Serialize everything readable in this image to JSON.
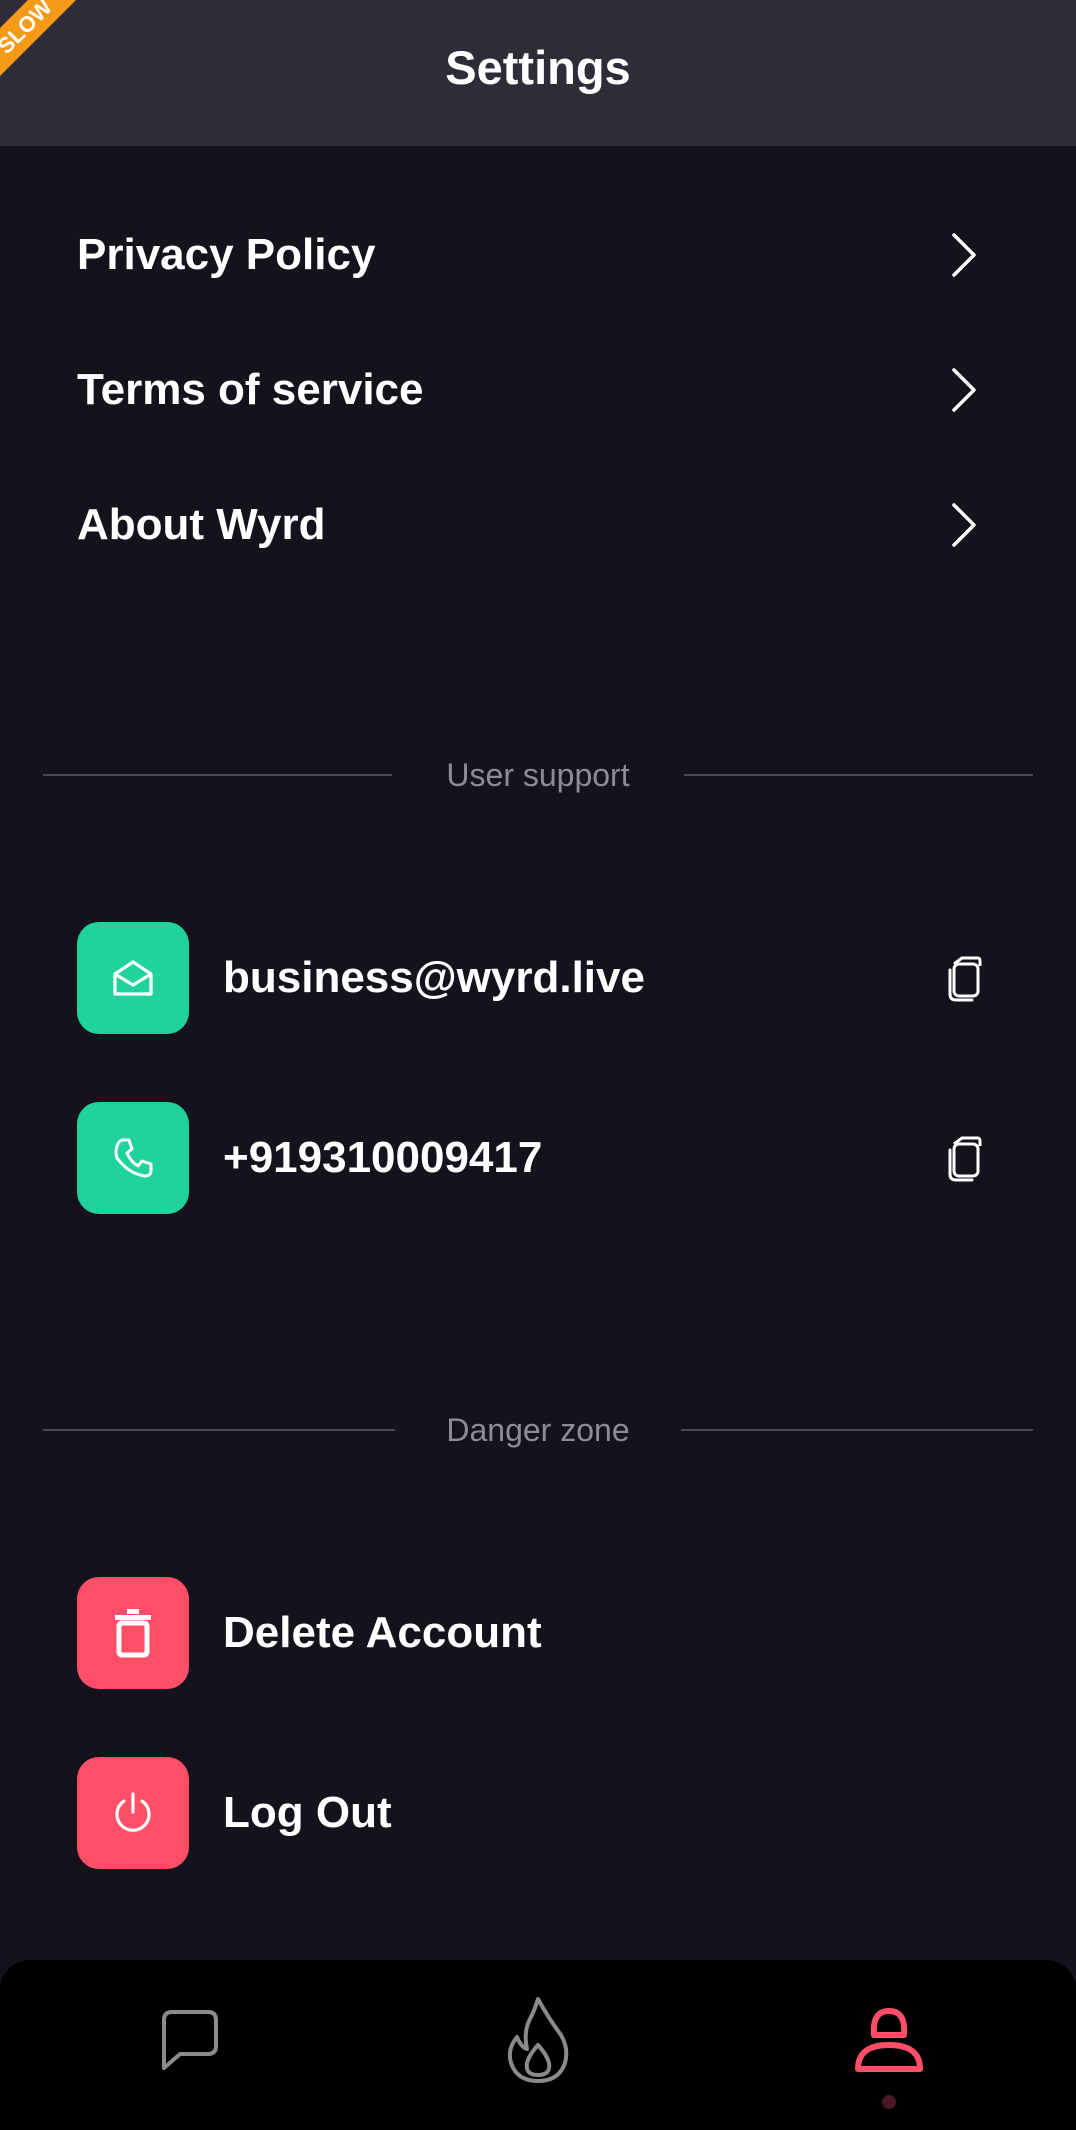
{
  "header": {
    "title": "Settings",
    "debug_banner": "SLOW"
  },
  "links": [
    {
      "label": "Privacy Policy"
    },
    {
      "label": "Terms of service"
    },
    {
      "label": "About Wyrd"
    }
  ],
  "support": {
    "section_label": "User support",
    "email": "business@wyrd.live",
    "phone": "+919310009417"
  },
  "danger": {
    "section_label": "Danger zone",
    "delete_label": "Delete Account",
    "logout_label": "Log Out"
  },
  "bottom_nav": {
    "tabs": [
      {
        "icon": "chat-bubble-icon",
        "active": false
      },
      {
        "icon": "flame-icon",
        "active": false
      },
      {
        "icon": "profile-icon",
        "active": true
      }
    ]
  },
  "colors": {
    "background": "#14121a",
    "header": "#2f2c38",
    "accent_green": "#1fd39b",
    "accent_red": "#ff4e67",
    "nav_inactive": "#8a8a8a"
  }
}
